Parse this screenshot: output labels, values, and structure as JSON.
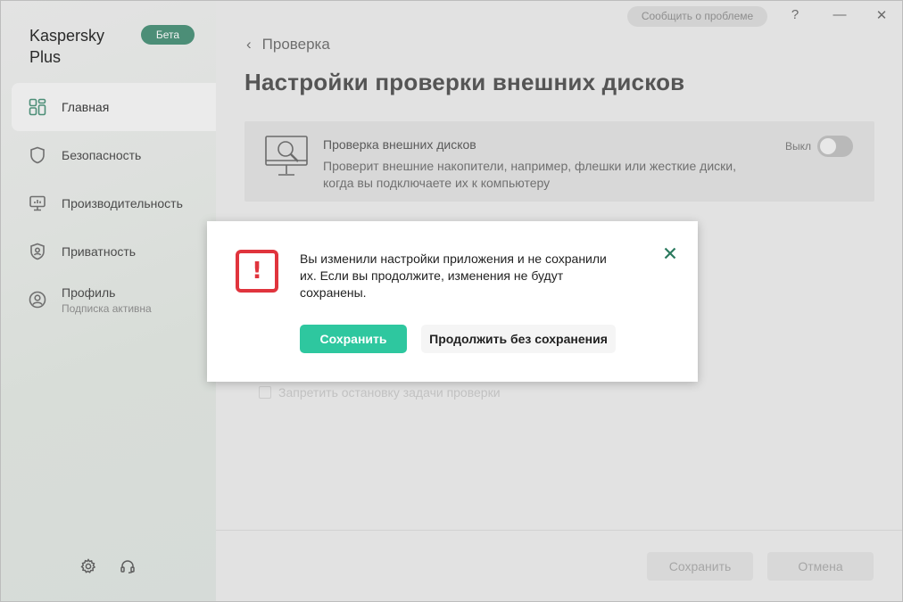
{
  "app": {
    "brand": "Kaspersky Plus",
    "badge": "Бета"
  },
  "sidebar": {
    "items": [
      {
        "label": "Главная",
        "icon": "dashboard-icon",
        "active": true
      },
      {
        "label": "Безопасность",
        "icon": "shield-icon"
      },
      {
        "label": "Производительность",
        "icon": "monitor-speed-icon"
      },
      {
        "label": "Приватность",
        "icon": "privacy-shield-icon"
      },
      {
        "label": "Профиль",
        "sub": "Подписка активна",
        "icon": "user-icon"
      }
    ],
    "bottom_icons": [
      "gear-icon",
      "headset-icon"
    ]
  },
  "titlebar": {
    "report": "Сообщить о проблеме",
    "help": "?",
    "minimize": "—",
    "close": "✕"
  },
  "main": {
    "breadcrumb": "Проверка",
    "title": "Настройки проверки внешних дисков",
    "card": {
      "title": "Проверка внешних дисков",
      "description": "Проверит внешние накопители, например, флешки или жесткие диски, когда вы подключаете их к компьютеру",
      "toggle_label": "Выкл",
      "toggle_on": false
    },
    "faded_option": "Запретить остановку задачи проверки",
    "footer": {
      "save": "Сохранить",
      "cancel": "Отмена"
    }
  },
  "dialog": {
    "icon": "warning-icon",
    "icon_glyph": "!",
    "message": "Вы изменили настройки приложения и не сохранили их. Если вы продолжите, изменения не будут сохранены.",
    "save": "Сохранить",
    "continue": "Продолжить без сохранения",
    "accent": "#2ec79f",
    "warning_color": "#e0343d"
  }
}
